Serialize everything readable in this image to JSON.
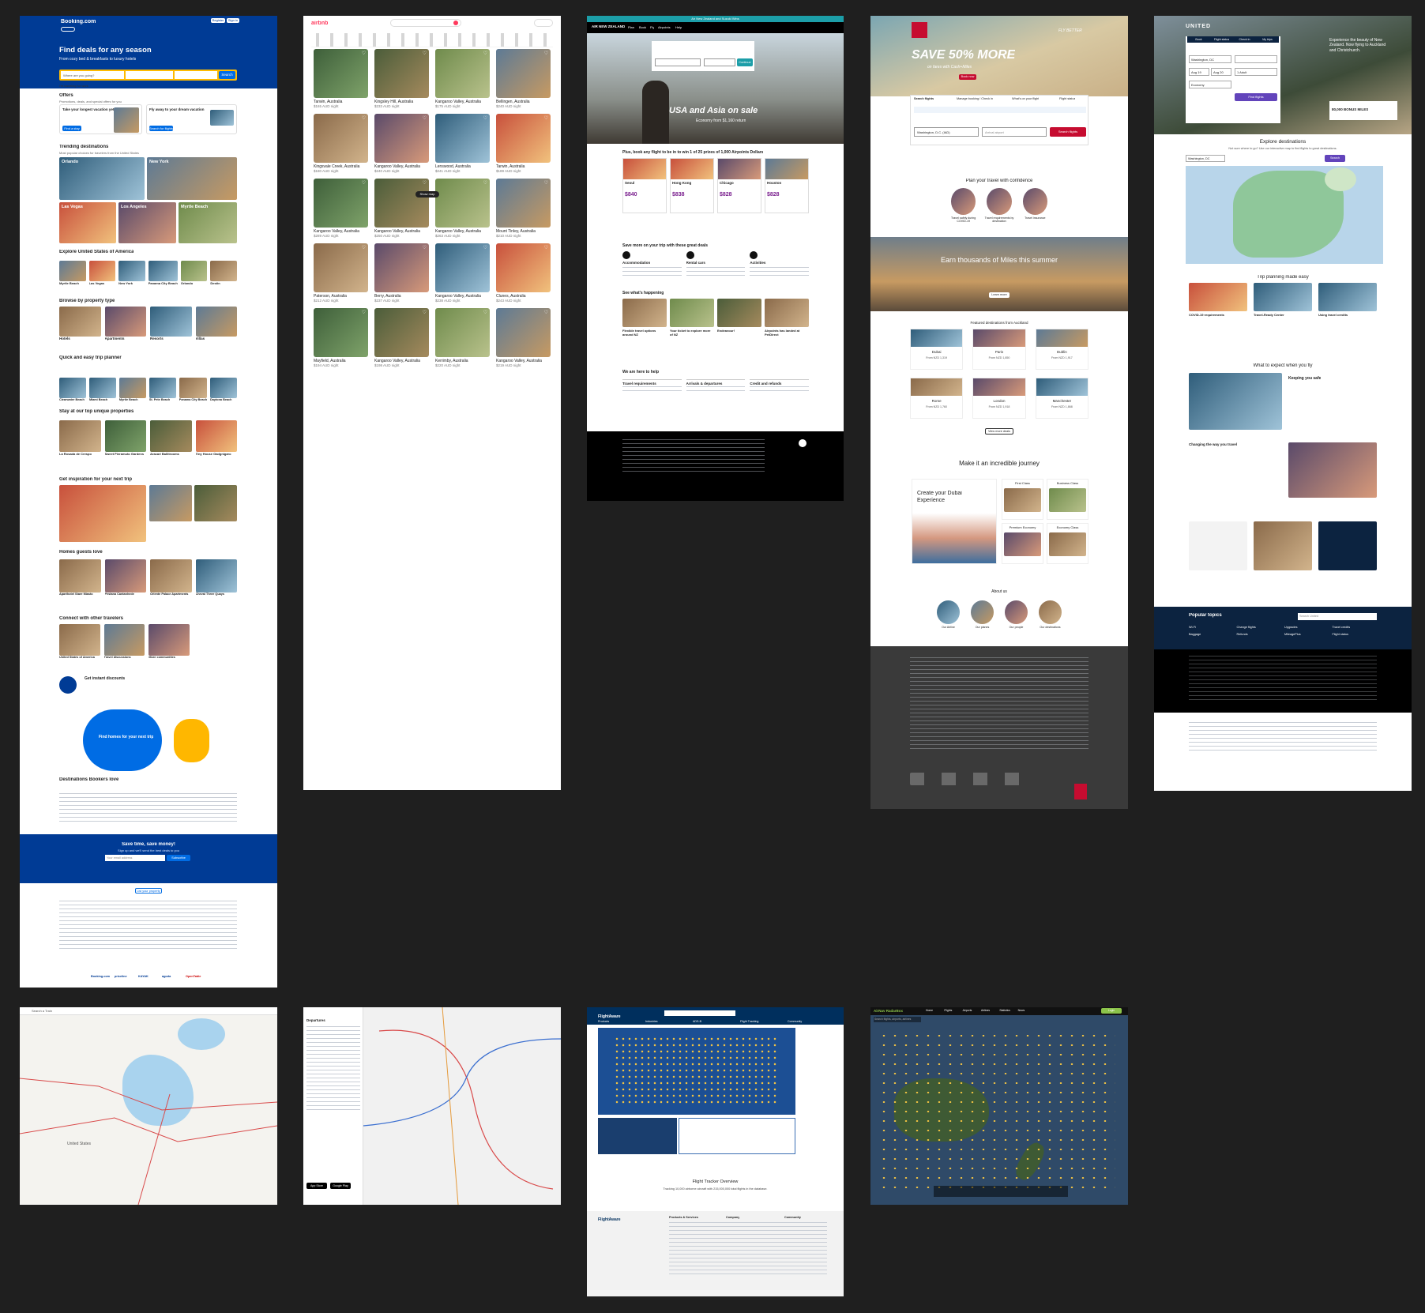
{
  "booking": {
    "logo": "Booking.com",
    "hero_title": "Find deals for any season",
    "hero_sub": "From cozy bed & breakfasts to luxury hotels",
    "search_placeholder": "Where are you going?",
    "search_button": "Search",
    "checkbox_label": "I'm traveling for work",
    "offers_title": "Offers",
    "offers_sub": "Promotions, deals, and special offers for you",
    "offer1_title": "Take your longest vacation yet",
    "offer1_button": "Find a stay",
    "offer2_title": "Fly away to your dream vacation",
    "offer2_button": "Search for flights",
    "trending_title": "Trending destinations",
    "trending_sub": "Most popular choices for travelers from the United States",
    "trending": [
      "Orlando",
      "New York",
      "Las Vegas",
      "Los Angeles",
      "Myrtle Beach"
    ],
    "explore_title": "Explore United States of America",
    "explore_sub": "These popular destinations have a lot to offer",
    "explore": [
      "Myrtle Beach",
      "Las Vegas",
      "New York",
      "Panama City Beach",
      "Orlando",
      "Destin"
    ],
    "property_title": "Browse by property type",
    "property": [
      "Hotels",
      "Apartments",
      "Resorts",
      "Villas"
    ],
    "trip_title": "Quick and easy trip planner",
    "trip": [
      "Clearwater Beach",
      "Miami Beach",
      "Myrtle Beach",
      "St. Pete Beach",
      "Panama City Beach",
      "Daytona Beach"
    ],
    "unique_title": "Stay at our top unique properties",
    "unique": [
      "La Rosada de Crespo",
      "Sweet Pieramuto Gardens",
      "Aracari Ballitrooms",
      "Tiny House Gadgnigaro"
    ],
    "inspiration_title": "Get inspiration for your next trip",
    "homes_title": "Homes guests love",
    "homes": [
      "Aparthotel Stare Miasto",
      "Pestana Cantanhede",
      "Oriente Palace Apartments",
      "Cheval Three Quays"
    ],
    "connect_title": "Connect with other travelers",
    "connect": [
      "United States of America",
      "Travel discussions",
      "More communities"
    ],
    "instant_title": "Get instant discounts",
    "promo_title": "Find homes for your next trip",
    "dest_title": "Destinations Bookers love",
    "save_title": "Save time, save money!",
    "save_sub": "Sign up and we'll send the best deals to you",
    "email_placeholder": "Your email address",
    "subscribe": "Subscribe",
    "list_property": "List your property",
    "footer_brands": [
      "Booking.com",
      "priceline",
      "KAYAK",
      "agoda",
      "OpenTable"
    ]
  },
  "airbnb": {
    "logo": "airbnb",
    "listings": [
      {
        "title": "Tarwin, Australia",
        "price": "$165 AUD night"
      },
      {
        "title": "Kingsley Hill, Australia",
        "price": "$233 AUD night"
      },
      {
        "title": "Kangaroo Valley, Australia",
        "price": "$175 AUD night"
      },
      {
        "title": "Bellingen, Australia",
        "price": "$240 AUD night"
      },
      {
        "title": "Kingsvale Creek, Australia",
        "price": "$180 AUD night"
      },
      {
        "title": "Kangaroo Valley, Australia",
        "price": "$240 AUD night"
      },
      {
        "title": "Lenswood, Australia",
        "price": "$241 AUD night"
      },
      {
        "title": "Tarwin, Australia",
        "price": "$189 AUD night"
      },
      {
        "title": "Kangaroo Valley, Australia",
        "price": "$289 AUD night"
      },
      {
        "title": "Kangaroo Valley, Australia",
        "price": "$250 AUD night"
      },
      {
        "title": "Kangaroo Valley, Australia",
        "price": "$263 AUD night"
      },
      {
        "title": "Mount Tinley, Australia",
        "price": "$210 AUD night"
      },
      {
        "title": "Paterson, Australia",
        "price": "$212 AUD night"
      },
      {
        "title": "Berry, Australia",
        "price": "$237 AUD night"
      },
      {
        "title": "Kangaroo Valley, Australia",
        "price": "$238 AUD night"
      },
      {
        "title": "Clunes, Australia",
        "price": "$243 AUD night"
      },
      {
        "title": "Mayfield, Australia",
        "price": "$194 AUD night"
      },
      {
        "title": "Kangaroo Valley, Australia",
        "price": "$198 AUD night"
      },
      {
        "title": "Kerrimby, Australia",
        "price": "$220 AUD night"
      },
      {
        "title": "Kangaroo Valley, Australia",
        "price": "$219 AUD night"
      }
    ],
    "show_map": "Show map"
  },
  "airnz": {
    "banner": "Air New Zealand and Suzuki Wins",
    "logo": "AIR NEW ZEALAND",
    "nav": [
      "Plan",
      "Book",
      "Fly",
      "Airpoints",
      "Help"
    ],
    "hero_title": "USA and Asia on sale",
    "hero_sub": "Economy from $1,160 return",
    "search_button": "Continue",
    "promo_title": "Plus, book any flight to be in to win 1 of 25 prizes of 1,000 Airpoints Dollars",
    "deals": [
      {
        "city": "Seoul",
        "price": "$840"
      },
      {
        "city": "Hong Kong",
        "price": "$838"
      },
      {
        "city": "Chicago",
        "price": "$828"
      },
      {
        "city": "Houston",
        "price": "$828"
      }
    ],
    "save_title": "Save more on your trip with these great deals",
    "save_items": [
      "Accommodation",
      "Rental cars",
      "Activities"
    ],
    "happening_title": "See what's happening",
    "happening": [
      "Flexible travel options around NZ",
      "Your ticket to explore more of NZ",
      "Endeavour!",
      "Airpoints has landed at PetDirect"
    ],
    "help_title": "We are here to help",
    "help_items": [
      "Travel requirements",
      "Arrivals & departures",
      "Credit and refunds"
    ]
  },
  "emirates": {
    "hero_title": "SAVE 50% MORE",
    "hero_sub": "on fares with Cash+Miles",
    "hero_button": "Book now",
    "tagline": "FLY BETTER",
    "tabs": [
      "Search flights",
      "Manage booking / Check in",
      "What's on your flight",
      "Flight status"
    ],
    "from_value": "Washington, D.C. (IAD)",
    "to_placeholder": "Arrival airport",
    "search_button": "Search flights",
    "confidence_title": "Plan your travel with confidence",
    "confidence": [
      "Travel safely during COVID-19",
      "Travel requirements by destination",
      "Travel insurance"
    ],
    "miles_title": "Earn thousands of Miles this summer",
    "miles_button": "Learn more",
    "featured_title": "Featured destinations from Auckland",
    "destinations": [
      {
        "city": "Dubai",
        "price": "From NZD 1,319"
      },
      {
        "city": "Paris",
        "price": "From NZD 1,850"
      },
      {
        "city": "Dublin",
        "price": "From NZD 1,917"
      },
      {
        "city": "Rome",
        "price": "From NZD 1,760"
      },
      {
        "city": "London",
        "price": "From NZD 1,918"
      },
      {
        "city": "Manchester",
        "price": "From NZD 1,868"
      }
    ],
    "view_more": "View more deals",
    "journey_title": "Make it an incredible journey",
    "journey_card": "Create your Dubai Experience",
    "cabins": [
      "First Class",
      "Business Class",
      "Premium Economy",
      "Economy Class"
    ],
    "about_title": "About us",
    "about": [
      "Our Airline",
      "Our planes",
      "Our people",
      "Our destinations"
    ]
  },
  "united": {
    "logo": "UNITED",
    "tabs": [
      "Book",
      "Flight status",
      "Check in",
      "My trips"
    ],
    "from_value": "Washington, DC",
    "depart": "Aug 19",
    "return": "Aug 20",
    "travelers": "1 Adult",
    "cabin": "Economy",
    "find_button": "Find flights",
    "hero_title": "Experience the beauty of New Zealand. Now flying to Auckland and Christchurch.",
    "miles_badge": "80,000 BONUS MILES",
    "explore_title": "Explore destinations",
    "explore_sub": "Not sure where to go? Use our interactive map to find flights to great destinations.",
    "explore_from": "Washington, DC",
    "search_button": "Search",
    "planning_title": "Trip planning made easy",
    "planning": [
      "COVID-19 requirements",
      "Travel-Ready Center",
      "Using travel credits"
    ],
    "expect_title": "What to expect when you fly",
    "safe_title": "Keeping you safe",
    "changing_title": "Changing the way you travel",
    "popular_title": "Popular topics",
    "popular_search": "Search United",
    "popular": [
      "Wi-Fi",
      "Change flights",
      "Upgrades",
      "Travel credits",
      "Baggage",
      "Refunds",
      "MileagePlus",
      "Flight status"
    ]
  },
  "map1": {
    "search_placeholder": "Search a Train",
    "country": "United States"
  },
  "rail": {
    "sidebar_title": "Departures",
    "app_store": "App Store",
    "google_play": "Google Play"
  },
  "flightaware": {
    "logo": "FlightAware",
    "nav": [
      "Products",
      "Industries",
      "ADS-B",
      "Flight Tracking",
      "Community"
    ],
    "title": "Flight Tracker Overview",
    "stats": "Tracking 10,000 airborne aircraft with 215,000,000 total flights in the database.",
    "footer_cols": [
      "Products & Services",
      "Company",
      "Community"
    ]
  },
  "airnav": {
    "logo": "AirNav RadarBox",
    "nav": [
      "Home",
      "Flights",
      "Airports",
      "Airlines",
      "Statistics",
      "News"
    ],
    "search_placeholder": "Search flights, airports, airlines",
    "login": "Login"
  }
}
